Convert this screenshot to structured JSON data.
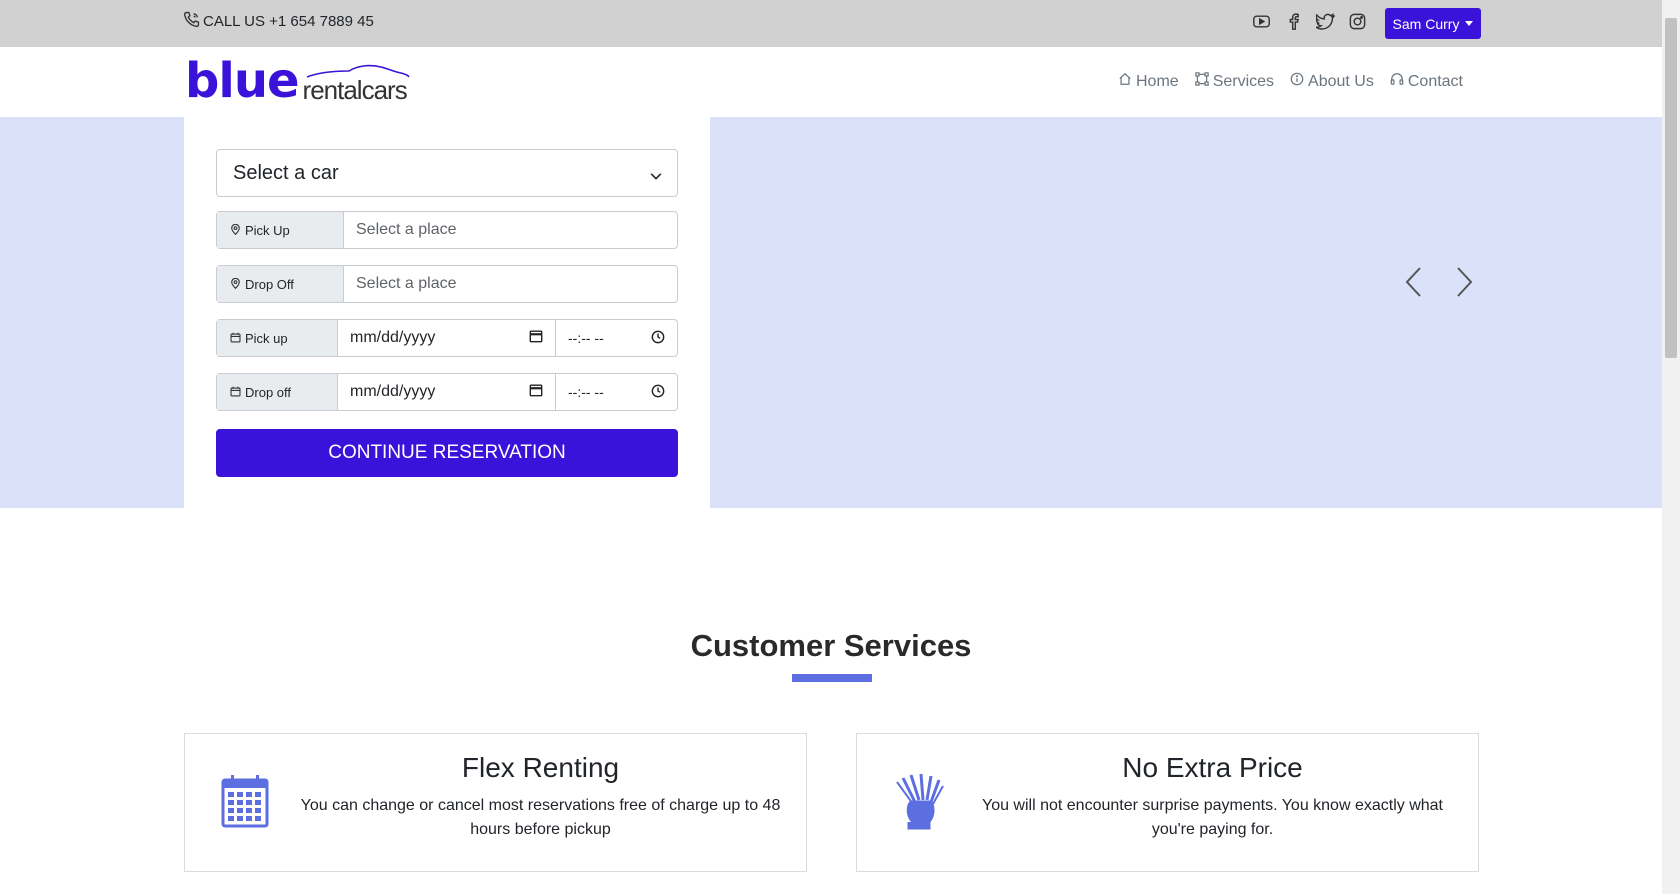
{
  "topbar": {
    "call_text": "CALL US +1 654 7889 45",
    "social_icons": [
      "youtube-icon",
      "facebook-icon",
      "twitter-icon",
      "instagram-icon"
    ],
    "user_name": "Sam Curry"
  },
  "brand": {
    "part1": "blue",
    "part2": "rentalcars"
  },
  "nav": {
    "items": [
      {
        "label": "Home",
        "icon": "home-icon"
      },
      {
        "label": "Services",
        "icon": "vector-icon"
      },
      {
        "label": "About Us",
        "icon": "info-icon"
      },
      {
        "label": "Contact",
        "icon": "headset-icon"
      }
    ]
  },
  "form": {
    "car_select": "Select a car",
    "pickup_label": "Pick Up",
    "pickup_placeholder": "Select a place",
    "dropoff_label": "Drop Off",
    "dropoff_placeholder": "Select a place",
    "pickup_date_label": "Pick up",
    "dropoff_date_label": "Drop off",
    "date_placeholder": "mm/dd/yyyy",
    "time_placeholder": "--:-- --",
    "submit": "CONTINUE RESERVATION"
  },
  "services": {
    "title": "Customer Services",
    "cards": [
      {
        "title": "Flex Renting",
        "text": "You can change or cancel most reservations free of charge up to 48 hours before pickup",
        "icon": "calendar-icon"
      },
      {
        "title": "No Extra Price",
        "text": "You will not encounter surprise payments. You know exactly what you're paying for.",
        "icon": "money-hand-icon"
      }
    ]
  },
  "colors": {
    "brand": "#3a12d9",
    "hero_bg": "#dbe1f8",
    "accent_bar": "#5c6ee0"
  }
}
